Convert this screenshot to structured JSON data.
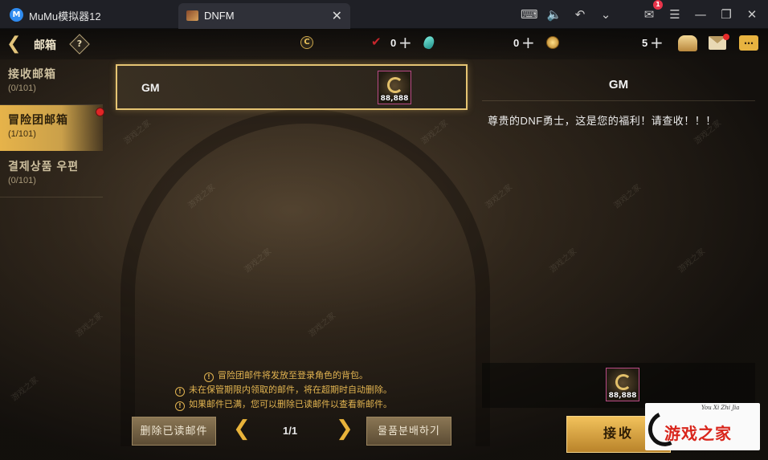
{
  "window": {
    "app_title": "MuMu模拟器12",
    "tab_label": "DNFM",
    "notification_count": "1"
  },
  "header": {
    "title": "邮箱",
    "help_symbol": "?",
    "currencies": [
      {
        "icon": "c-coin-icon",
        "value": ""
      },
      {
        "icon": "v-mark-icon",
        "value": "0"
      },
      {
        "icon": "gem-icon",
        "value": "0"
      },
      {
        "icon": "gold-coin-icon",
        "value": "5"
      }
    ]
  },
  "sidebar": {
    "tabs": [
      {
        "label": "接收邮箱",
        "count": "(0/101)"
      },
      {
        "label": "冒险团邮箱",
        "count": "(1/101)"
      },
      {
        "label": "결제상품 우편",
        "count": "(0/101)"
      }
    ],
    "active_index": 1
  },
  "mail_list": [
    {
      "sender": "GM",
      "item_qty": "88,888"
    }
  ],
  "detail": {
    "sender": "GM",
    "body": "尊贵的DNF勇士，这是您的福利！请查收！！！",
    "reward_qty": "88,888"
  },
  "notices": [
    "冒险团邮件将发放至登录角色的背包。",
    "未在保管期限内领取的邮件，将在超期时自动删除。",
    "如果邮件已满，您可以删除已读邮件以查看新邮件。"
  ],
  "footer": {
    "delete_read_label": "删除已读邮件",
    "page_indicator": "1/1",
    "distribute_label": "물품분배하기",
    "receive_label": "接收"
  },
  "watermark": {
    "logo_text": "游戏之家",
    "logo_small": "You Xi Zhi Jia",
    "tile_text": "游戏之家"
  },
  "colors": {
    "accent_gold": "#e5c473",
    "active_tab": "#e6b34a",
    "notice_text": "#e2b451",
    "unread_dot": "#e02626"
  }
}
